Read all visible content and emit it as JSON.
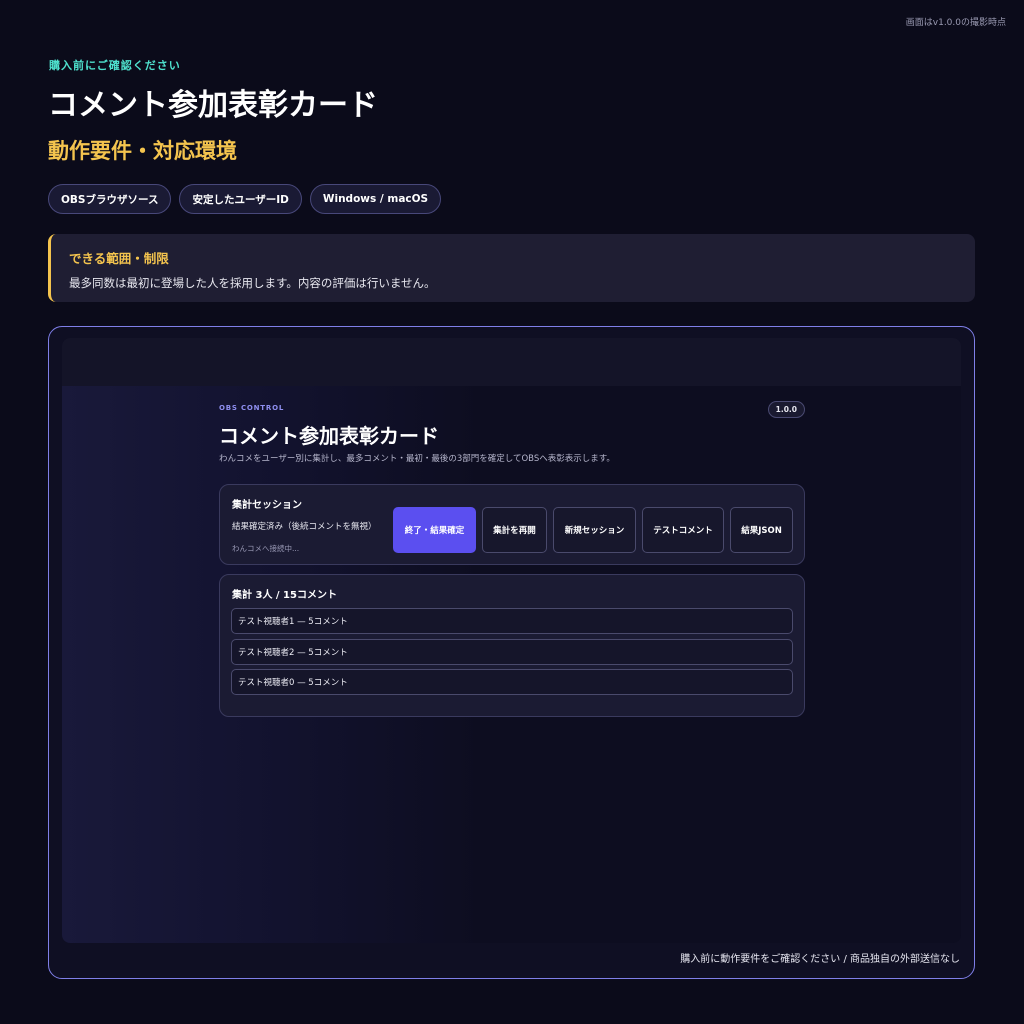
{
  "version_note": "画面はv1.0.0の撮影時点",
  "eyebrow": "購入前にご確認ください",
  "title": "コメント参加表彰カード",
  "subtitle": "動作要件・対応環境",
  "tags": [
    "OBSブラウザソース",
    "安定したユーザーID",
    "Windows / macOS"
  ],
  "limits": {
    "title": "できる範囲・制限",
    "text": "最多同数は最初に登場した人を採用します。内容の評価は行いません。"
  },
  "screenshot": {
    "eyebrow": "OBS CONTROL",
    "title": "コメント参加表彰カード",
    "version": "1.0.0",
    "description": "わんコメをユーザー別に集計し、最多コメント・最初・最後の3部門を確定してOBSへ表彰表示します。",
    "session": {
      "title": "集計セッション",
      "status": "結果確定済み（後続コメントを無視）",
      "connection": "わんコメへ接続中...",
      "buttons": [
        "終了・結果確定",
        "集計を再開",
        "新規セッション",
        "テストコメント",
        "結果JSON"
      ]
    },
    "summary": {
      "title": "集計 3人 / 15コメント",
      "rows": [
        "テスト視聴者1 — 5コメント",
        "テスト視聴者2 — 5コメント",
        "テスト視聴者0 — 5コメント"
      ]
    }
  },
  "footer": "購入前に動作要件をご確認ください / 商品独自の外部送信なし",
  "colors": {
    "background": "#0b0b1a",
    "accent_teal": "#4fe3cf",
    "accent_yellow": "#f4c44e",
    "frame_border": "#7f7fe8",
    "primary_button": "#5b4ff0"
  }
}
